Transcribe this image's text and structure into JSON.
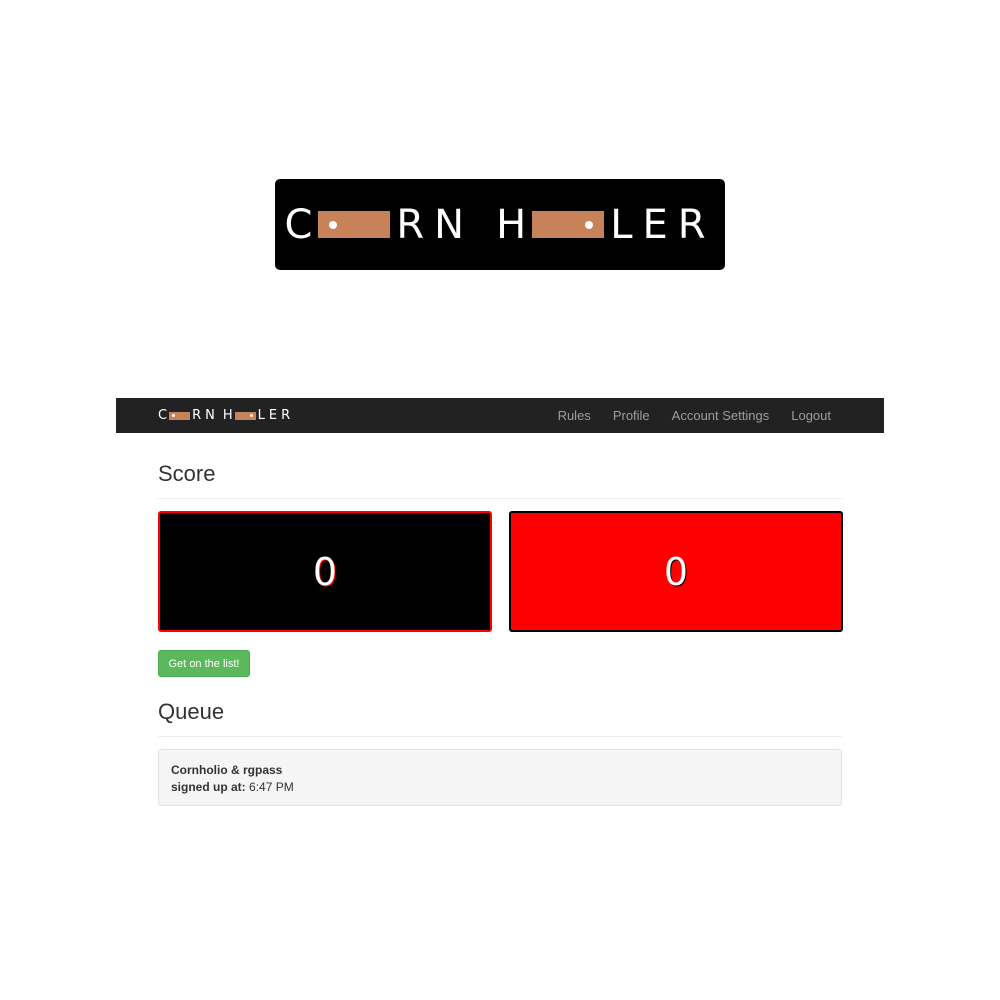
{
  "logo": {
    "text_parts": [
      "C",
      "RN",
      "H",
      "LER"
    ],
    "board_color": "#c8825a"
  },
  "navbar": {
    "links": [
      "Rules",
      "Profile",
      "Account Settings",
      "Logout"
    ]
  },
  "score": {
    "title": "Score",
    "left": {
      "value": "0",
      "bg": "#000000",
      "border": "#ff0000"
    },
    "right": {
      "value": "0",
      "bg": "#ff0000",
      "border": "#000000"
    }
  },
  "signup_button": "Get on the list!",
  "queue": {
    "title": "Queue",
    "entries": [
      {
        "names": "Cornholio & rgpass",
        "signed_label": "signed up at:",
        "time": "6:47 PM"
      }
    ]
  }
}
